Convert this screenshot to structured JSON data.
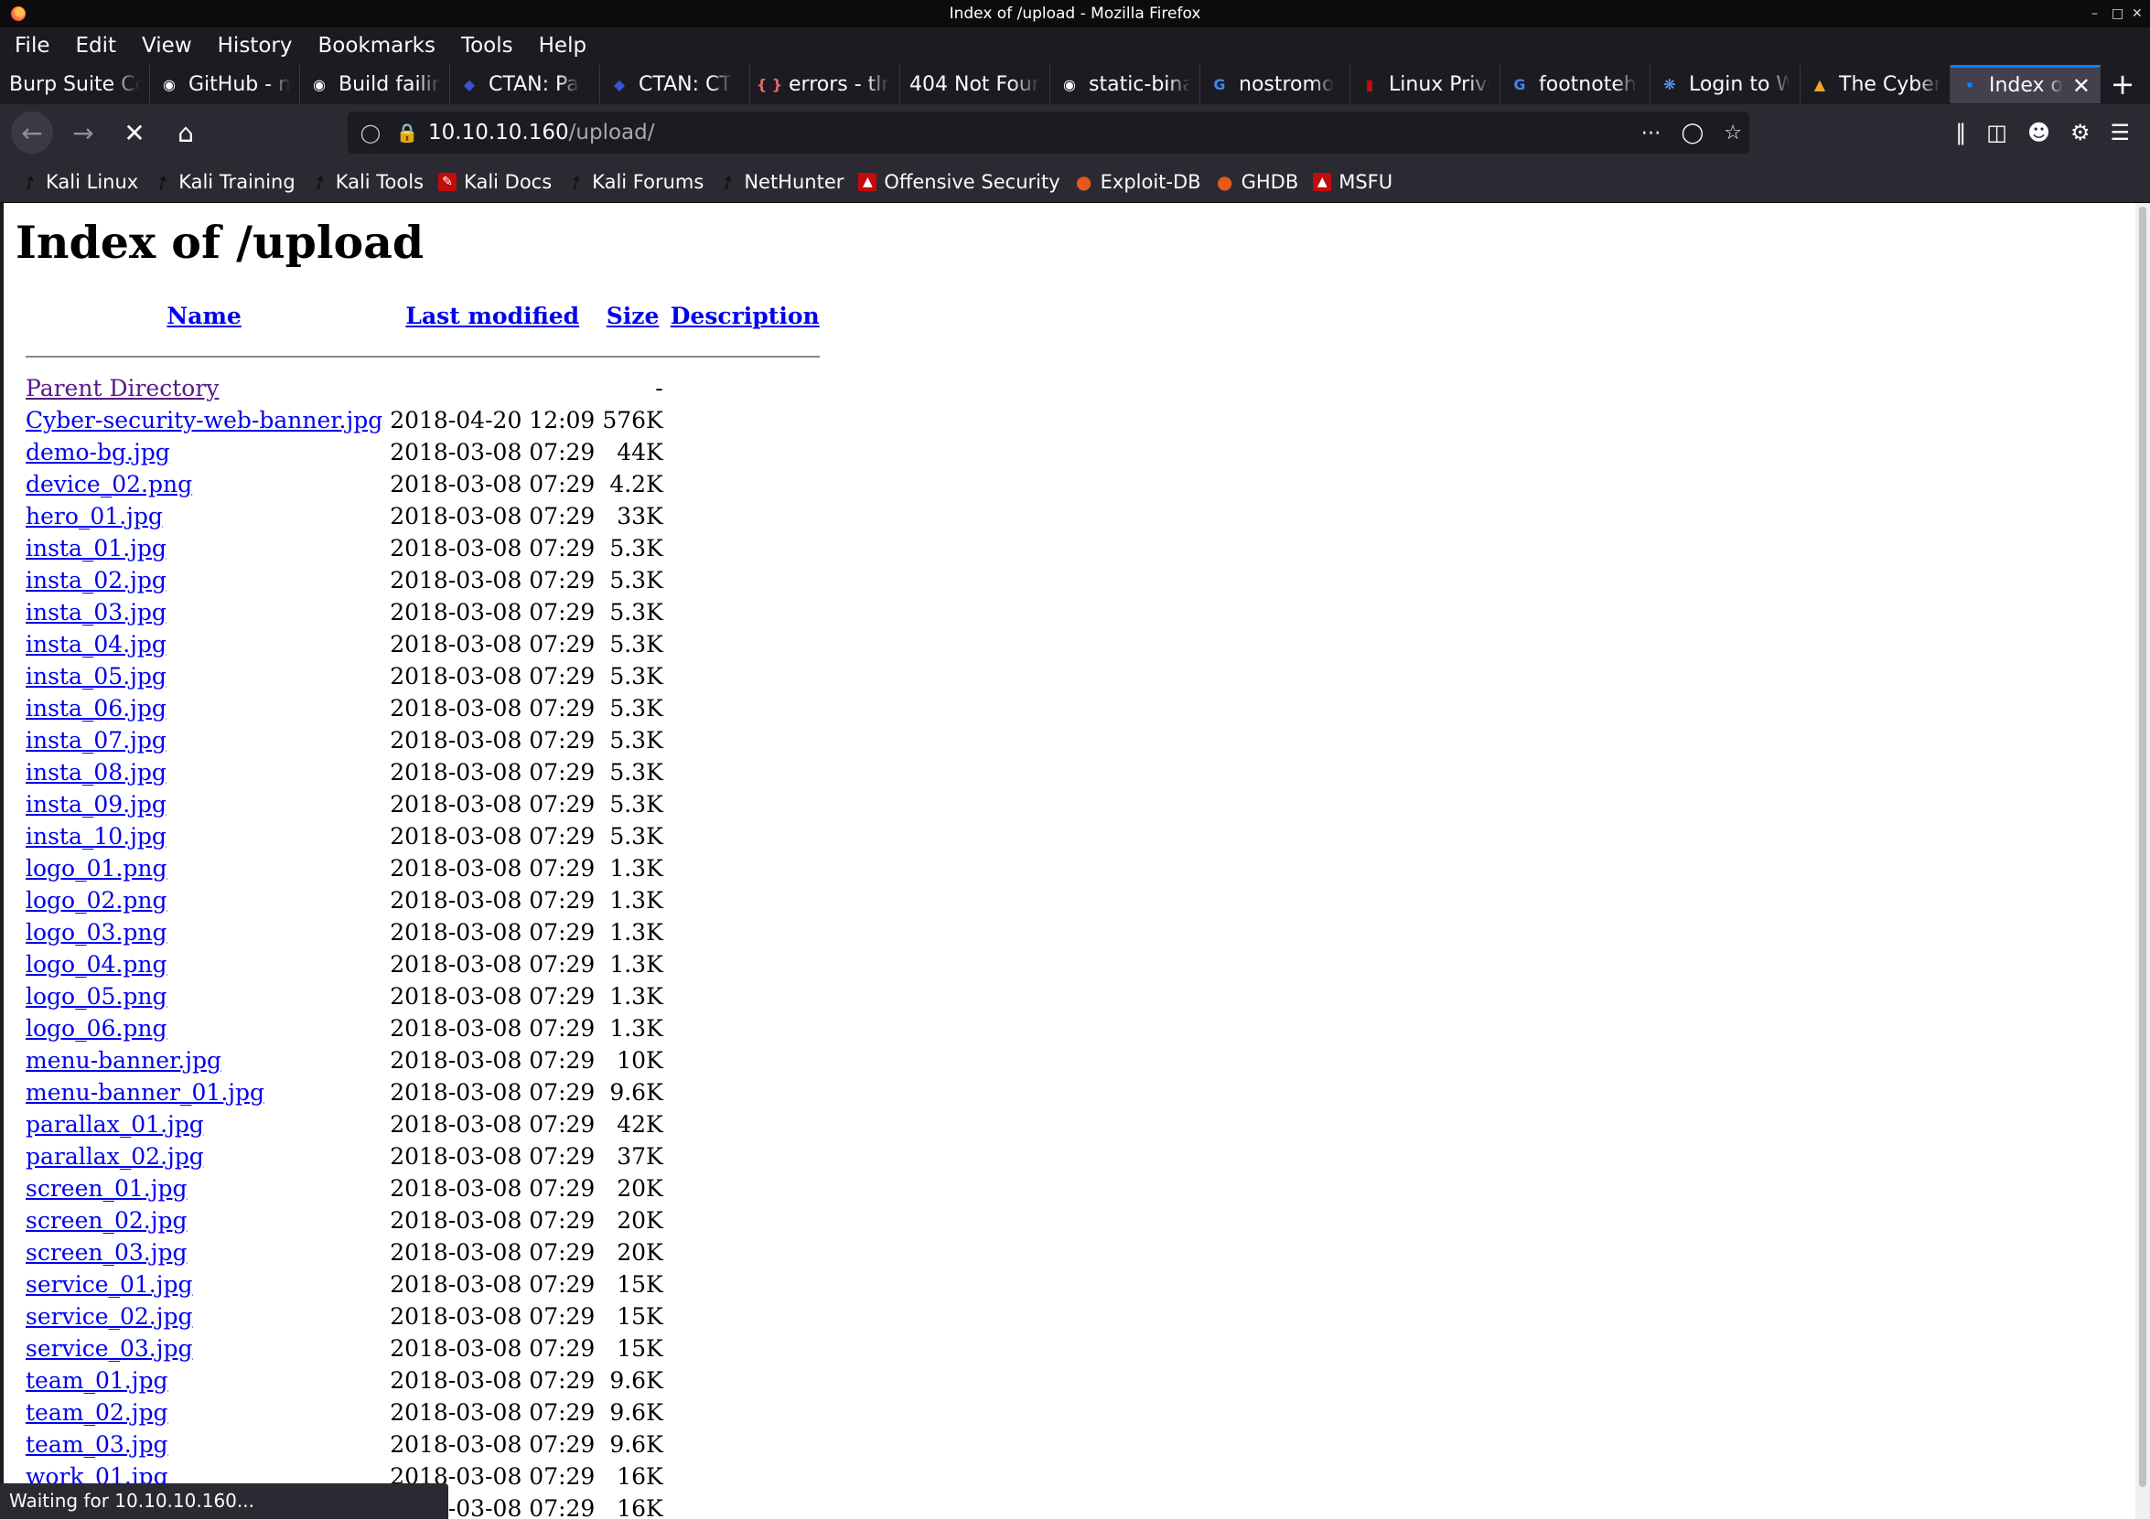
{
  "window": {
    "title": "Index of /upload - Mozilla Firefox"
  },
  "menu": [
    "File",
    "Edit",
    "View",
    "History",
    "Bookmarks",
    "Tools",
    "Help"
  ],
  "tabs": [
    {
      "label": "Burp Suite Co",
      "icon": "none"
    },
    {
      "label": "GitHub - n",
      "icon": "github-icon"
    },
    {
      "label": "Build failin",
      "icon": "github-icon"
    },
    {
      "label": "CTAN: Pa",
      "icon": "ctan-icon"
    },
    {
      "label": "CTAN: CT",
      "icon": "ctan-icon"
    },
    {
      "label": "errors - tlr",
      "icon": "braces-icon"
    },
    {
      "label": "404 Not Four",
      "icon": "none"
    },
    {
      "label": "static-bina",
      "icon": "github-icon"
    },
    {
      "label": "nostromo",
      "icon": "google-icon"
    },
    {
      "label": "Linux Privi",
      "icon": "book-icon"
    },
    {
      "label": "footnoteh",
      "icon": "google-icon"
    },
    {
      "label": "Login to W",
      "icon": "cluster-icon"
    },
    {
      "label": "The Cyber",
      "icon": "hat-icon"
    },
    {
      "label": "Index o",
      "icon": "dot-icon",
      "active": true
    }
  ],
  "navbar": {
    "url_host": "10.10.10.160",
    "url_path": "/upload/"
  },
  "bookmarks": [
    {
      "label": "Kali Linux",
      "icon": "kali-dragon-icon"
    },
    {
      "label": "Kali Training",
      "icon": "kali-dragon-icon"
    },
    {
      "label": "Kali Tools",
      "icon": "kali-dragon-icon"
    },
    {
      "label": "Kali Docs",
      "icon": "kali-docs-icon"
    },
    {
      "label": "Kali Forums",
      "icon": "kali-dragon-icon"
    },
    {
      "label": "NetHunter",
      "icon": "kali-dragon-icon"
    },
    {
      "label": "Offensive Security",
      "icon": "offsec-icon"
    },
    {
      "label": "Exploit-DB",
      "icon": "exploitdb-icon"
    },
    {
      "label": "GHDB",
      "icon": "exploitdb-icon"
    },
    {
      "label": "MSFU",
      "icon": "offsec-icon"
    }
  ],
  "page": {
    "heading": "Index of /upload",
    "columns": {
      "name": "Name",
      "modified": "Last modified",
      "size": "Size",
      "description": "Description"
    },
    "parent": {
      "name": "Parent Directory",
      "size": "-"
    },
    "files": [
      {
        "name": "Cyber-security-web-banner.jpg",
        "modified": "2018-04-20 12:09",
        "size": "576K"
      },
      {
        "name": "demo-bg.jpg",
        "modified": "2018-03-08 07:29",
        "size": "44K"
      },
      {
        "name": "device_02.png",
        "modified": "2018-03-08 07:29",
        "size": "4.2K"
      },
      {
        "name": "hero_01.jpg",
        "modified": "2018-03-08 07:29",
        "size": "33K"
      },
      {
        "name": "insta_01.jpg",
        "modified": "2018-03-08 07:29",
        "size": "5.3K"
      },
      {
        "name": "insta_02.jpg",
        "modified": "2018-03-08 07:29",
        "size": "5.3K"
      },
      {
        "name": "insta_03.jpg",
        "modified": "2018-03-08 07:29",
        "size": "5.3K"
      },
      {
        "name": "insta_04.jpg",
        "modified": "2018-03-08 07:29",
        "size": "5.3K"
      },
      {
        "name": "insta_05.jpg",
        "modified": "2018-03-08 07:29",
        "size": "5.3K"
      },
      {
        "name": "insta_06.jpg",
        "modified": "2018-03-08 07:29",
        "size": "5.3K"
      },
      {
        "name": "insta_07.jpg",
        "modified": "2018-03-08 07:29",
        "size": "5.3K"
      },
      {
        "name": "insta_08.jpg",
        "modified": "2018-03-08 07:29",
        "size": "5.3K"
      },
      {
        "name": "insta_09.jpg",
        "modified": "2018-03-08 07:29",
        "size": "5.3K"
      },
      {
        "name": "insta_10.jpg",
        "modified": "2018-03-08 07:29",
        "size": "5.3K"
      },
      {
        "name": "logo_01.png",
        "modified": "2018-03-08 07:29",
        "size": "1.3K"
      },
      {
        "name": "logo_02.png",
        "modified": "2018-03-08 07:29",
        "size": "1.3K"
      },
      {
        "name": "logo_03.png",
        "modified": "2018-03-08 07:29",
        "size": "1.3K"
      },
      {
        "name": "logo_04.png",
        "modified": "2018-03-08 07:29",
        "size": "1.3K"
      },
      {
        "name": "logo_05.png",
        "modified": "2018-03-08 07:29",
        "size": "1.3K"
      },
      {
        "name": "logo_06.png",
        "modified": "2018-03-08 07:29",
        "size": "1.3K"
      },
      {
        "name": "menu-banner.jpg",
        "modified": "2018-03-08 07:29",
        "size": "10K"
      },
      {
        "name": "menu-banner_01.jpg",
        "modified": "2018-03-08 07:29",
        "size": "9.6K"
      },
      {
        "name": "parallax_01.jpg",
        "modified": "2018-03-08 07:29",
        "size": "42K"
      },
      {
        "name": "parallax_02.jpg",
        "modified": "2018-03-08 07:29",
        "size": "37K"
      },
      {
        "name": "screen_01.jpg",
        "modified": "2018-03-08 07:29",
        "size": "20K"
      },
      {
        "name": "screen_02.jpg",
        "modified": "2018-03-08 07:29",
        "size": "20K"
      },
      {
        "name": "screen_03.jpg",
        "modified": "2018-03-08 07:29",
        "size": "20K"
      },
      {
        "name": "service_01.jpg",
        "modified": "2018-03-08 07:29",
        "size": "15K"
      },
      {
        "name": "service_02.jpg",
        "modified": "2018-03-08 07:29",
        "size": "15K"
      },
      {
        "name": "service_03.jpg",
        "modified": "2018-03-08 07:29",
        "size": "15K"
      },
      {
        "name": "team_01.jpg",
        "modified": "2018-03-08 07:29",
        "size": "9.6K"
      },
      {
        "name": "team_02.jpg",
        "modified": "2018-03-08 07:29",
        "size": "9.6K"
      },
      {
        "name": "team_03.jpg",
        "modified": "2018-03-08 07:29",
        "size": "9.6K"
      },
      {
        "name": "work_01.jpg",
        "modified": "2018-03-08 07:29",
        "size": "16K"
      },
      {
        "name": "",
        "modified": "2018-03-08 07:29",
        "size": "16K"
      }
    ]
  },
  "status": "Waiting for 10.10.10.160..."
}
